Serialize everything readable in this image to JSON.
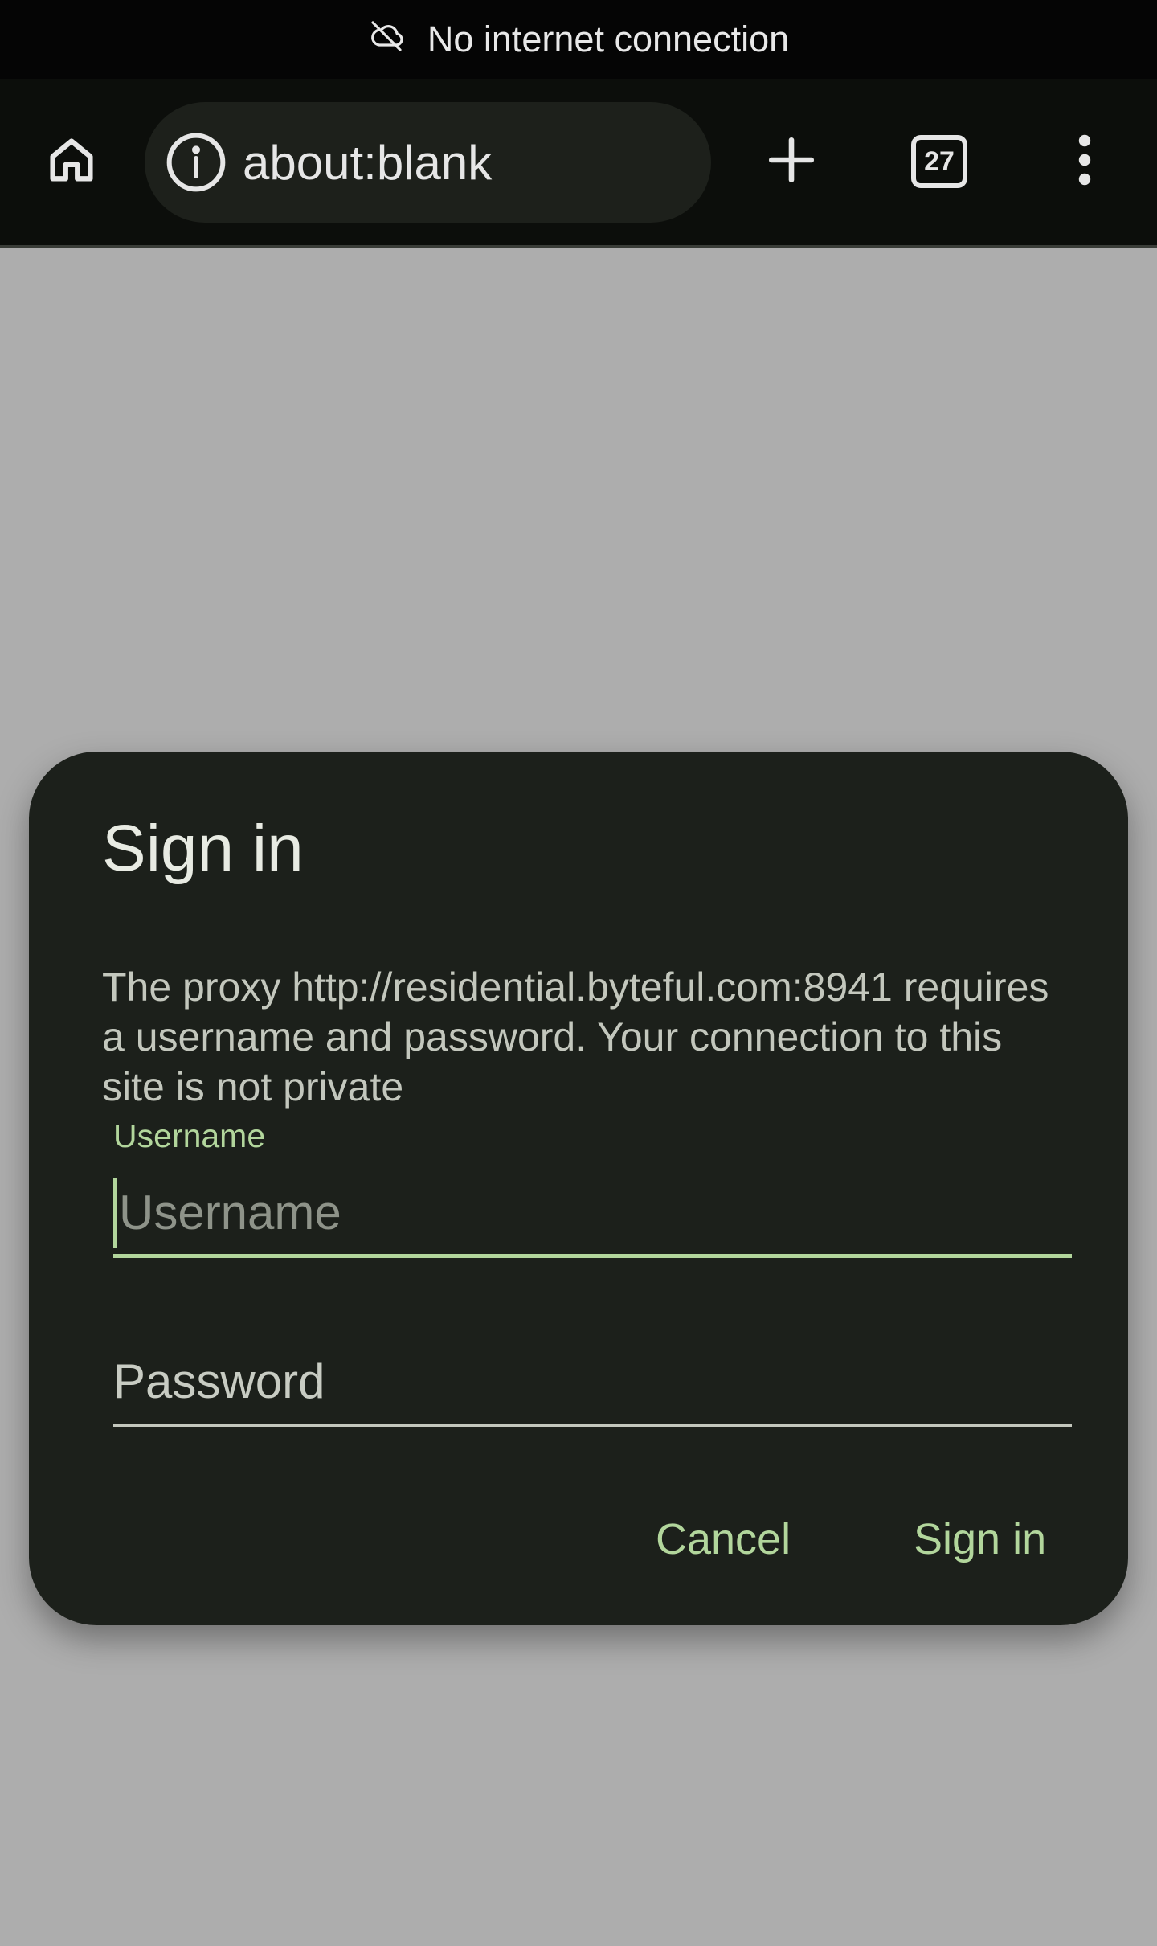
{
  "status_bar": {
    "text": "No internet connection",
    "icon": "cloud-off-icon"
  },
  "toolbar": {
    "home_icon": "home-icon",
    "omnibox": {
      "icon": "info-icon",
      "url": "about:blank"
    },
    "new_tab_icon": "plus-icon",
    "tab_count": "27",
    "menu_icon": "more-vert-icon"
  },
  "dialog": {
    "title": "Sign in",
    "message": "The proxy http://residential.byteful.com:8941 requires a username and password. Your connection to this site is not private",
    "username_label": "Username",
    "username_placeholder": "Username",
    "password_placeholder": "Password",
    "cancel_label": "Cancel",
    "signin_label": "Sign in"
  },
  "colors": {
    "accent": "#b2d69c",
    "dialog_bg": "#1c201b",
    "scrim": "#adadad",
    "toolbar_bg": "#0c0e0b"
  }
}
